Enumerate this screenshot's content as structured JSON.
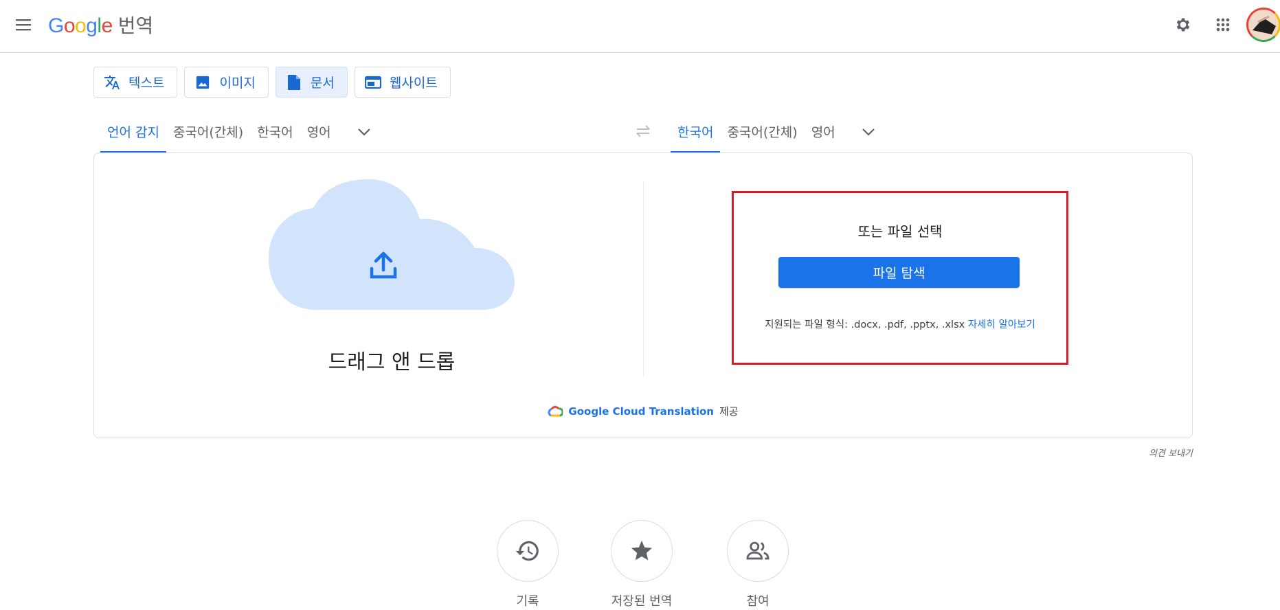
{
  "header": {
    "logo_word": "Google",
    "logo_colors": [
      "#4285f4",
      "#ea4335",
      "#fbbc04",
      "#4285f4",
      "#34a853",
      "#ea4335"
    ],
    "product": "번역",
    "icons": [
      "menu-icon",
      "gear-icon",
      "apps-grid-icon"
    ]
  },
  "modes": [
    {
      "label": "텍스트",
      "icon": "translate-icon"
    },
    {
      "label": "이미지",
      "icon": "image-icon"
    },
    {
      "label": "문서",
      "icon": "document-icon",
      "active": true
    },
    {
      "label": "웹사이트",
      "icon": "website-icon"
    }
  ],
  "source_languages": [
    "언어 감지",
    "중국어(간체)",
    "한국어",
    "영어"
  ],
  "target_languages": [
    "한국어",
    "중국어(간체)",
    "영어"
  ],
  "upload": {
    "drag_text": "드래그 앤 드롭",
    "or_text": "또는 파일 선택",
    "browse_button": "파일 탐색",
    "formats_text": "지원되는 파일 형식: .docx, .pdf, .pptx, .xlsx",
    "learn_more": "자세히 알아보기"
  },
  "powered_by": {
    "brand": "Google Cloud Translation",
    "suffix": "제공"
  },
  "feedback": "의견 보내기",
  "actions": [
    {
      "label": "기록",
      "icon": "history-icon"
    },
    {
      "label": "저장된 번역",
      "icon": "star-icon"
    },
    {
      "label": "참여",
      "icon": "people-icon"
    }
  ],
  "colors": {
    "accent": "#1a73e8",
    "active_tab_bg": "#e8f0fe",
    "cloud": "#d2e3fc",
    "highlight_box": "#d11d2c"
  }
}
